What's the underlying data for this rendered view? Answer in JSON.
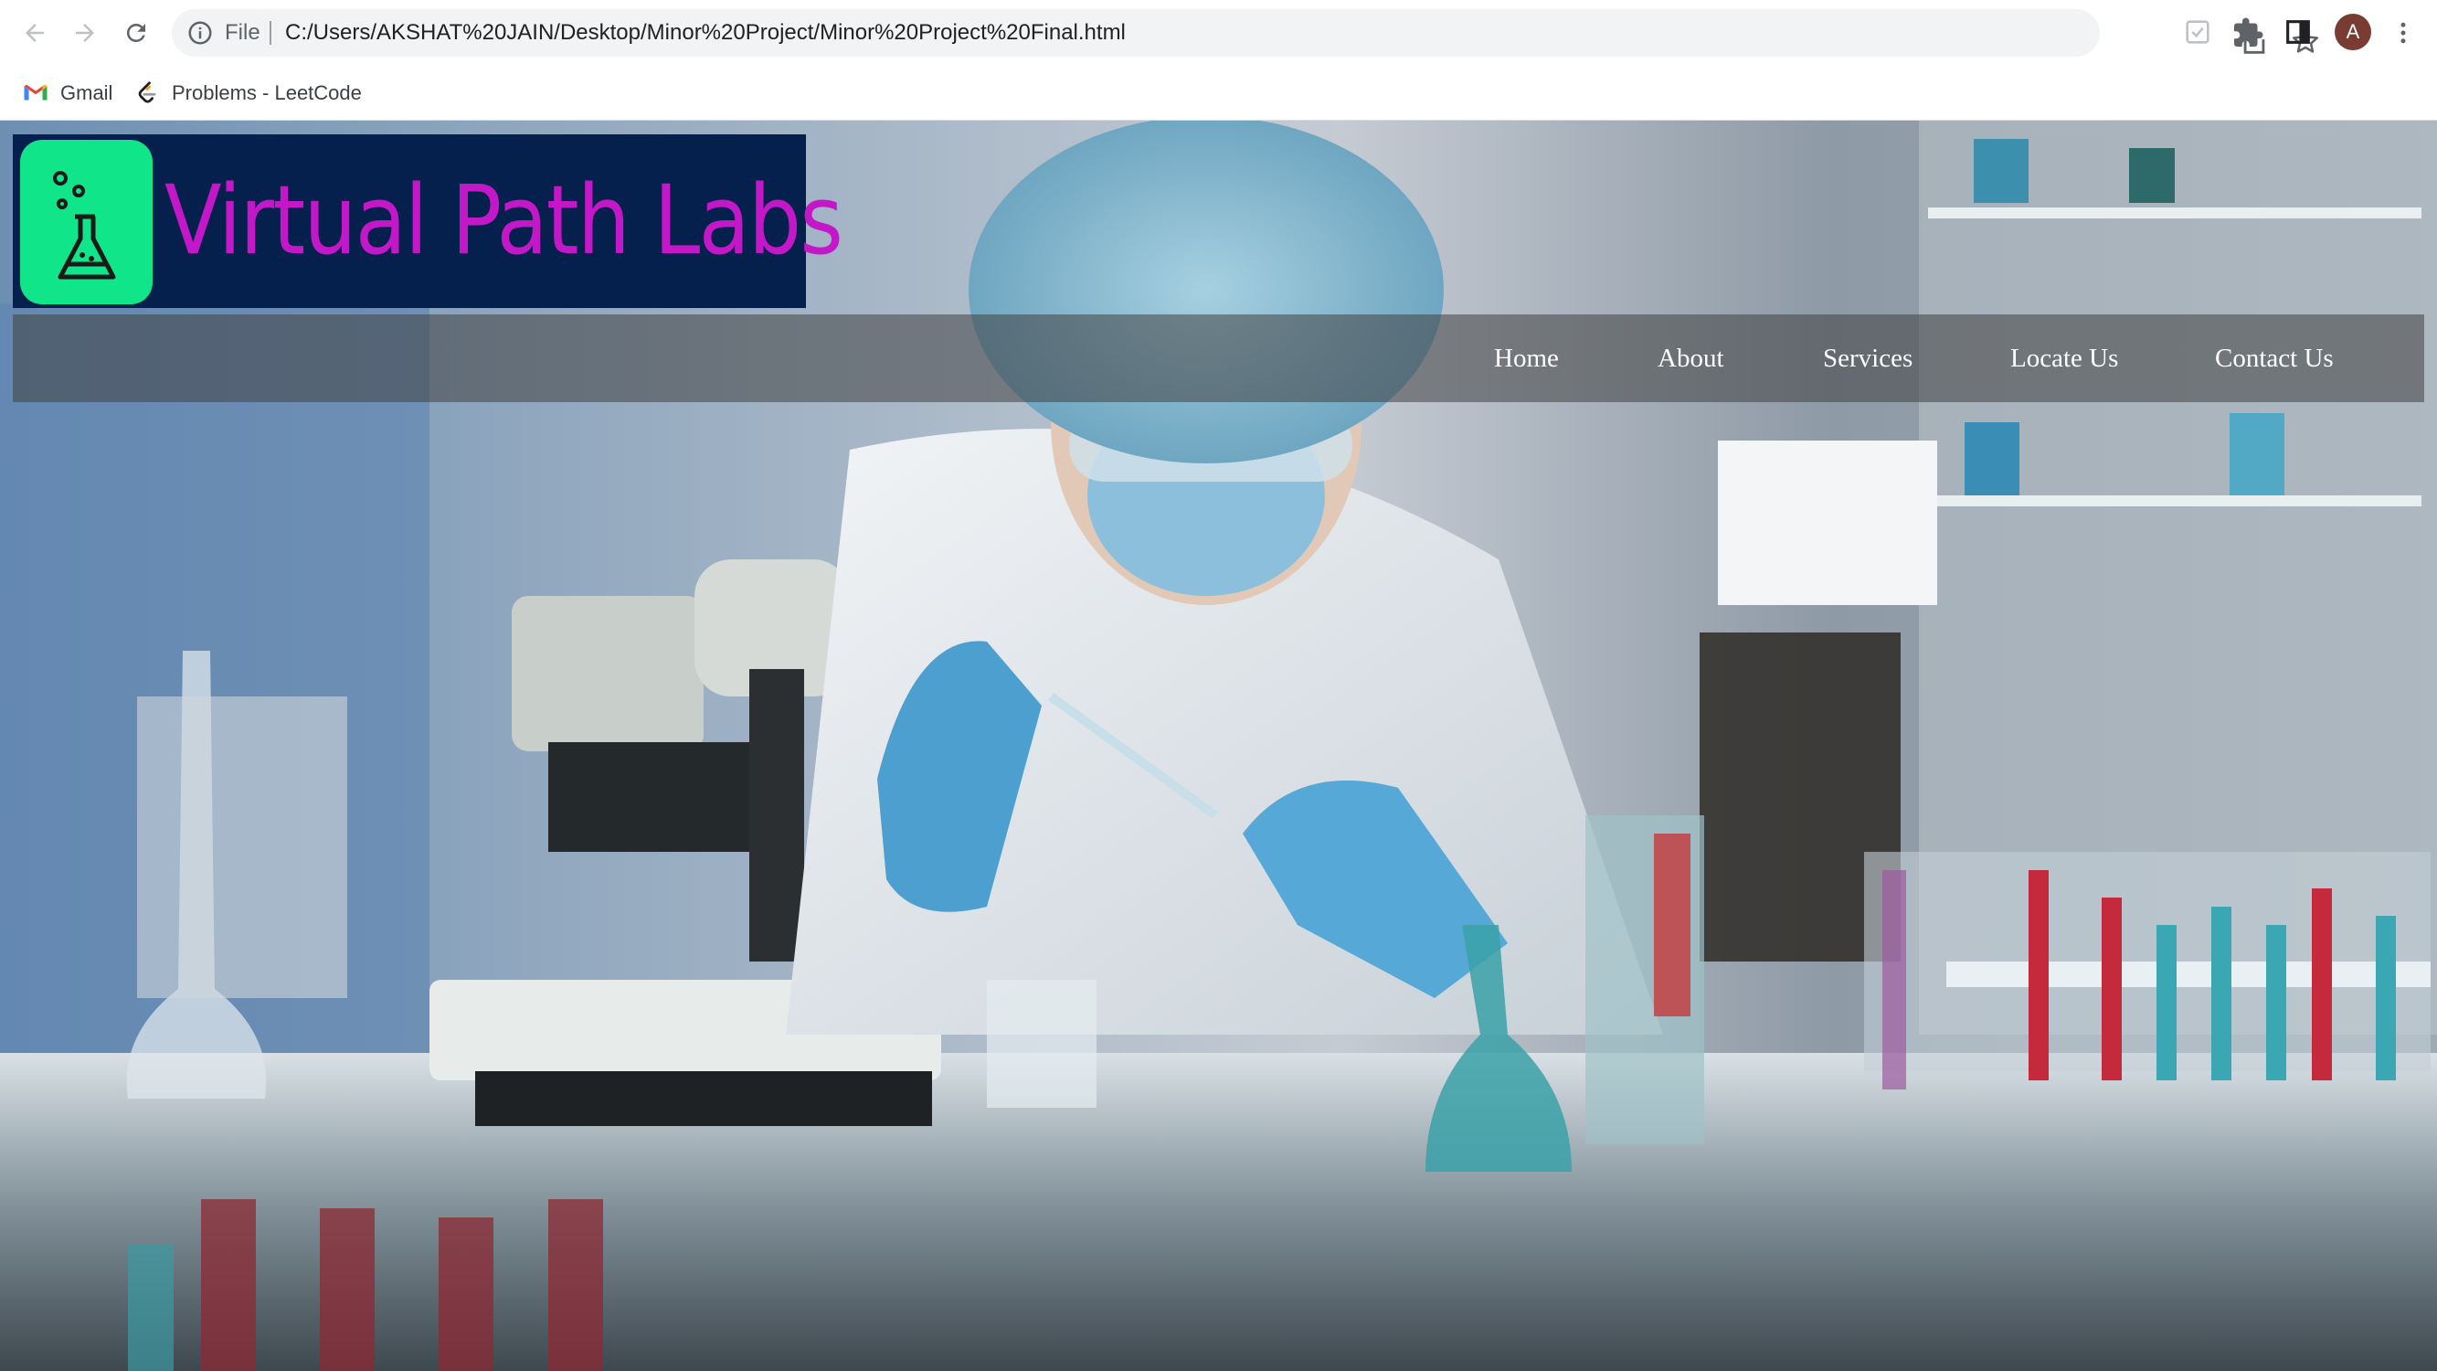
{
  "browser": {
    "omnibox": {
      "scheme_label": "File",
      "url": "C:/Users/AKSHAT%20JAIN/Desktop/Minor%20Project/Minor%20Project%20Final.html"
    },
    "profile_initial": "A",
    "bookmarks": [
      {
        "label": "Gmail",
        "icon": "gmail-icon"
      },
      {
        "label": "Problems - LeetCode",
        "icon": "leetcode-icon"
      }
    ]
  },
  "site": {
    "logo": {
      "title": "Virtual Path Labs",
      "icon": "flask-icon",
      "brand_bg": "#06204d",
      "tile_color": "#11e589",
      "title_color": "#c318c8"
    },
    "nav": [
      {
        "label": "Home"
      },
      {
        "label": "About"
      },
      {
        "label": "Services"
      },
      {
        "label": "Locate Us"
      },
      {
        "label": "Contact Us"
      }
    ],
    "hero_image": "laboratory-scientist-photo"
  }
}
